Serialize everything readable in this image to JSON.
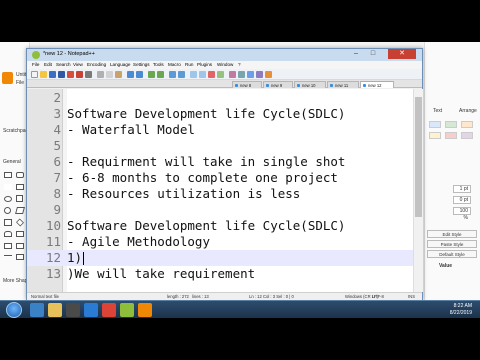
{
  "window": {
    "title": "*new 12 - Notepad++",
    "menu": [
      "File",
      "Edit",
      "Search",
      "View",
      "Encoding",
      "Language",
      "Settings",
      "Tools",
      "Macro",
      "Run",
      "Plugins",
      "Window",
      "?"
    ],
    "tabs": [
      {
        "label": "new 8",
        "active": false
      },
      {
        "label": "new 9",
        "active": false
      },
      {
        "label": "new 10",
        "active": false
      },
      {
        "label": "new 11",
        "active": false
      },
      {
        "label": "new 12",
        "active": true
      }
    ],
    "controls": {
      "minimize": "–",
      "maximize": "□",
      "close": "✕"
    }
  },
  "editor": {
    "lines": [
      {
        "num": "2",
        "text": ""
      },
      {
        "num": "3",
        "text": "Software Development life Cycle(SDLC)"
      },
      {
        "num": "4",
        "text": "- Waterfall Model"
      },
      {
        "num": "5",
        "text": ""
      },
      {
        "num": "6",
        "text": "- Requirment will take in single shot"
      },
      {
        "num": "7",
        "text": "- 6-8 months to complete one project"
      },
      {
        "num": "8",
        "text": "- Resources utilization is less"
      },
      {
        "num": "9",
        "text": ""
      },
      {
        "num": "10",
        "text": "Software Development life Cycle(SDLC)"
      },
      {
        "num": "11",
        "text": "- Agile Methodology"
      },
      {
        "num": "12",
        "text": "1)"
      },
      {
        "num": "13",
        "text": ")We will take requirement"
      }
    ],
    "current_line_index": 10
  },
  "statusbar": {
    "type": "Normal text file",
    "length": "length : 272",
    "lines": "lines : 13",
    "position": "Ln : 12    Col : 3    Sel : 0 | 0",
    "eol": "Windows (CR LF)",
    "encoding": "UTF-8",
    "mode": "INS"
  },
  "background_app": {
    "left_labels": [
      "Untitled",
      "File",
      "Scratchpad",
      "General",
      "More Shapes"
    ],
    "right_tabs": [
      "Text",
      "Arrange"
    ],
    "right_values": [
      "1 pt",
      "0 pt",
      "100 %"
    ],
    "right_buttons": [
      "Edit Style",
      "Paste Style",
      "Default Style"
    ],
    "right_section": "Value"
  },
  "taskbar": {
    "time": "8:22 AM",
    "date": "8/22/2019"
  },
  "colors": {
    "accent": "#f7a022",
    "current_line": "#e8e8ff",
    "taskbar": "#1b324b"
  }
}
